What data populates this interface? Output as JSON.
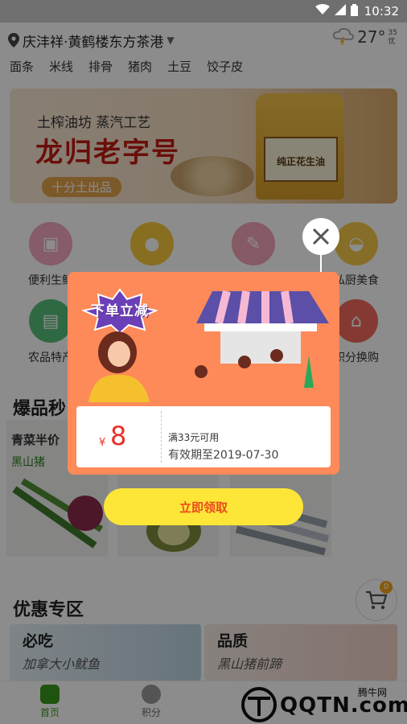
{
  "status_bar": {
    "time": "10:32"
  },
  "header": {
    "location": "庆沣祥·黄鹤楼东方茶港",
    "weather": {
      "temp": "27°",
      "aqi": "35",
      "aqi_label": "优"
    }
  },
  "quick_links": [
    "面条",
    "米线",
    "排骨",
    "猪肉",
    "土豆",
    "饺子皮"
  ],
  "banner": {
    "subtitle": "土榨油坊 蒸汽工艺",
    "title": "龙归老字号",
    "tag": "十分土出品",
    "product_label": "纯正花生油"
  },
  "categories": [
    {
      "label": "便利生鲜",
      "color": "#f5a6c2"
    },
    {
      "label": "",
      "color": "#f8c93b"
    },
    {
      "label": "",
      "color": "#f3a4b8"
    },
    {
      "label": "私厨美食",
      "color": "#f6c84a"
    },
    {
      "label": "农品特产",
      "color": "#56c07a"
    },
    {
      "label": "积分换购",
      "color": "#f06a5e"
    }
  ],
  "section_hot": {
    "title": "爆品秒"
  },
  "products": [
    {
      "name": "青菜半价",
      "tag": "黑山猪"
    },
    {
      "name": "",
      "tag": ""
    },
    {
      "name": "",
      "tag": ""
    }
  ],
  "section_promo": {
    "title": "优惠专区"
  },
  "promos": [
    {
      "title": "必吃",
      "subtitle": "加拿大小鱿鱼"
    },
    {
      "title": "品质",
      "subtitle": "黑山猪前蹄"
    }
  ],
  "cart": {
    "count": "0"
  },
  "tabs": [
    {
      "label": "首页",
      "active": true
    },
    {
      "label": "积分",
      "active": false
    }
  ],
  "watermark": {
    "text": "QQTN.com",
    "badge": "腾牛网"
  },
  "popup": {
    "badge": "下单立减",
    "currency": "¥",
    "amount": "8",
    "condition": "满33元可用",
    "validity": "有效期至2019-07-30",
    "claim_button": "立即领取"
  }
}
